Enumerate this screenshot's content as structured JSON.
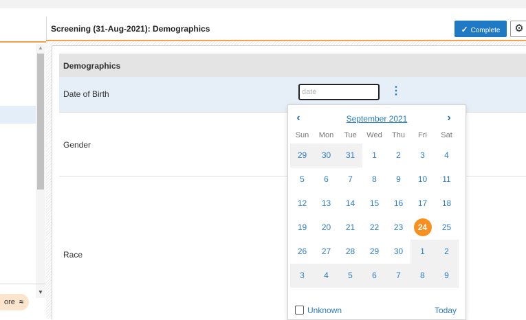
{
  "header": {
    "title": "Screening (31-Aug-2021): Demographics",
    "complete_label": "Complete",
    "check_icon": "✓",
    "gear_icon": "⚙"
  },
  "sidebar": {
    "more_label": "ore",
    "more_icon": "≈",
    "scroll_up_icon": "▲",
    "scroll_down_icon": "▼"
  },
  "form": {
    "section_title": "Demographics",
    "fields": {
      "dob_label": "Date of Birth",
      "dob_placeholder": "date",
      "dob_value": "",
      "gender_label": "Gender",
      "race_label": "Race"
    },
    "menu_icon": "⋮"
  },
  "datepicker": {
    "prev_icon": "‹",
    "next_icon": "›",
    "month_year": "September 2021",
    "weekdays": [
      "Sun",
      "Mon",
      "Tue",
      "Wed",
      "Thu",
      "Fri",
      "Sat"
    ],
    "weeks": [
      [
        {
          "d": "29",
          "m": true
        },
        {
          "d": "30",
          "m": true
        },
        {
          "d": "31",
          "m": true
        },
        {
          "d": "1"
        },
        {
          "d": "2"
        },
        {
          "d": "3"
        },
        {
          "d": "4"
        }
      ],
      [
        {
          "d": "5"
        },
        {
          "d": "6"
        },
        {
          "d": "7"
        },
        {
          "d": "8"
        },
        {
          "d": "9"
        },
        {
          "d": "10"
        },
        {
          "d": "11"
        }
      ],
      [
        {
          "d": "12"
        },
        {
          "d": "13"
        },
        {
          "d": "14"
        },
        {
          "d": "15"
        },
        {
          "d": "16"
        },
        {
          "d": "17"
        },
        {
          "d": "18"
        }
      ],
      [
        {
          "d": "19"
        },
        {
          "d": "20"
        },
        {
          "d": "21"
        },
        {
          "d": "22"
        },
        {
          "d": "23"
        },
        {
          "d": "24",
          "selected": true
        },
        {
          "d": "25"
        }
      ],
      [
        {
          "d": "26"
        },
        {
          "d": "27"
        },
        {
          "d": "28"
        },
        {
          "d": "29"
        },
        {
          "d": "30"
        },
        {
          "d": "1",
          "m": true
        },
        {
          "d": "2",
          "m": true
        }
      ],
      [
        {
          "d": "3",
          "m": true
        },
        {
          "d": "4",
          "m": true
        },
        {
          "d": "5",
          "m": true
        },
        {
          "d": "6",
          "m": true
        },
        {
          "d": "7",
          "m": true
        },
        {
          "d": "8",
          "m": true
        },
        {
          "d": "9",
          "m": true
        }
      ]
    ],
    "unknown_label": "Unknown",
    "today_label": "Today"
  },
  "colors": {
    "accent_orange": "#f7901e",
    "primary_blue": "#1f79c5",
    "link_blue": "#2d7cc4"
  }
}
